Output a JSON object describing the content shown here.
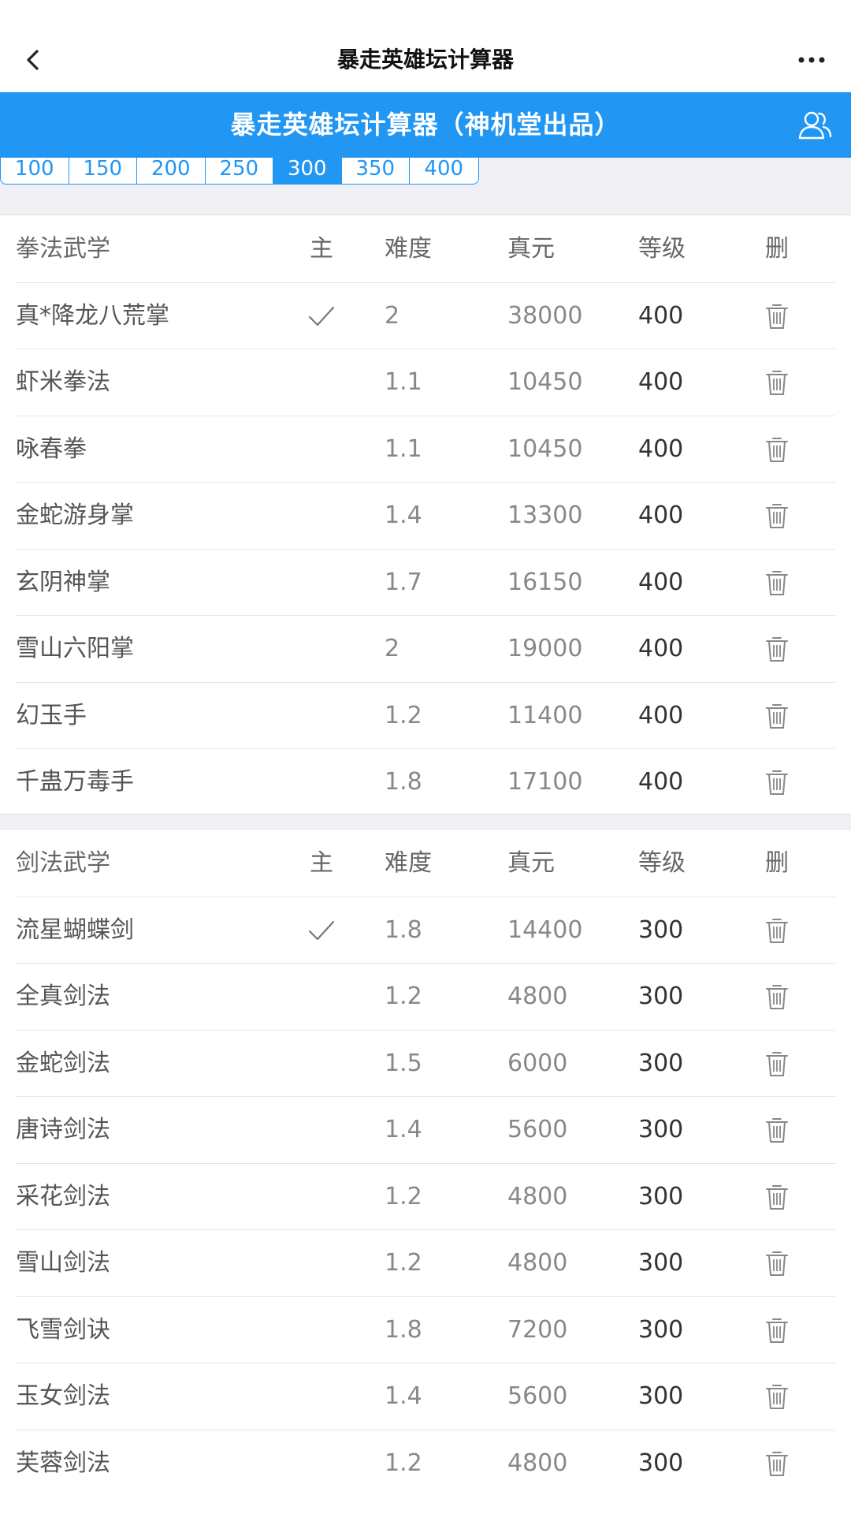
{
  "topbar": {
    "title": "暴走英雄坛计算器",
    "back_icon": "chevron-left-icon",
    "more_icon": "more-icon"
  },
  "header": {
    "title": "暴走英雄坛计算器（神机堂出品）",
    "user_icon": "user-group-icon"
  },
  "levels": {
    "options": [
      "100",
      "150",
      "200",
      "250",
      "300",
      "350",
      "400"
    ],
    "selected": "300"
  },
  "colors": {
    "accent": "#2196f3",
    "gap": "#efeff4"
  },
  "fist": {
    "headers": [
      "拳法武学",
      "主",
      "难度",
      "真元",
      "等级",
      "删"
    ],
    "rows": [
      {
        "name": "真*降龙八荒掌",
        "main": true,
        "diff": "2",
        "zhen": "38000",
        "level": "400"
      },
      {
        "name": "虾米拳法",
        "main": false,
        "diff": "1.1",
        "zhen": "10450",
        "level": "400"
      },
      {
        "name": "咏春拳",
        "main": false,
        "diff": "1.1",
        "zhen": "10450",
        "level": "400"
      },
      {
        "name": "金蛇游身掌",
        "main": false,
        "diff": "1.4",
        "zhen": "13300",
        "level": "400"
      },
      {
        "name": "玄阴神掌",
        "main": false,
        "diff": "1.7",
        "zhen": "16150",
        "level": "400"
      },
      {
        "name": "雪山六阳掌",
        "main": false,
        "diff": "2",
        "zhen": "19000",
        "level": "400"
      },
      {
        "name": "幻玉手",
        "main": false,
        "diff": "1.2",
        "zhen": "11400",
        "level": "400"
      },
      {
        "name": "千蛊万毒手",
        "main": false,
        "diff": "1.8",
        "zhen": "17100",
        "level": "400"
      }
    ]
  },
  "sword": {
    "headers": [
      "剑法武学",
      "主",
      "难度",
      "真元",
      "等级",
      "删"
    ],
    "rows": [
      {
        "name": "流星蝴蝶剑",
        "main": true,
        "diff": "1.8",
        "zhen": "14400",
        "level": "300"
      },
      {
        "name": "全真剑法",
        "main": false,
        "diff": "1.2",
        "zhen": "4800",
        "level": "300"
      },
      {
        "name": "金蛇剑法",
        "main": false,
        "diff": "1.5",
        "zhen": "6000",
        "level": "300"
      },
      {
        "name": "唐诗剑法",
        "main": false,
        "diff": "1.4",
        "zhen": "5600",
        "level": "300"
      },
      {
        "name": "采花剑法",
        "main": false,
        "diff": "1.2",
        "zhen": "4800",
        "level": "300"
      },
      {
        "name": "雪山剑法",
        "main": false,
        "diff": "1.2",
        "zhen": "4800",
        "level": "300"
      },
      {
        "name": "飞雪剑诀",
        "main": false,
        "diff": "1.8",
        "zhen": "7200",
        "level": "300"
      },
      {
        "name": "玉女剑法",
        "main": false,
        "diff": "1.4",
        "zhen": "5600",
        "level": "300"
      },
      {
        "name": "芙蓉剑法",
        "main": false,
        "diff": "1.2",
        "zhen": "4800",
        "level": "300"
      }
    ]
  }
}
